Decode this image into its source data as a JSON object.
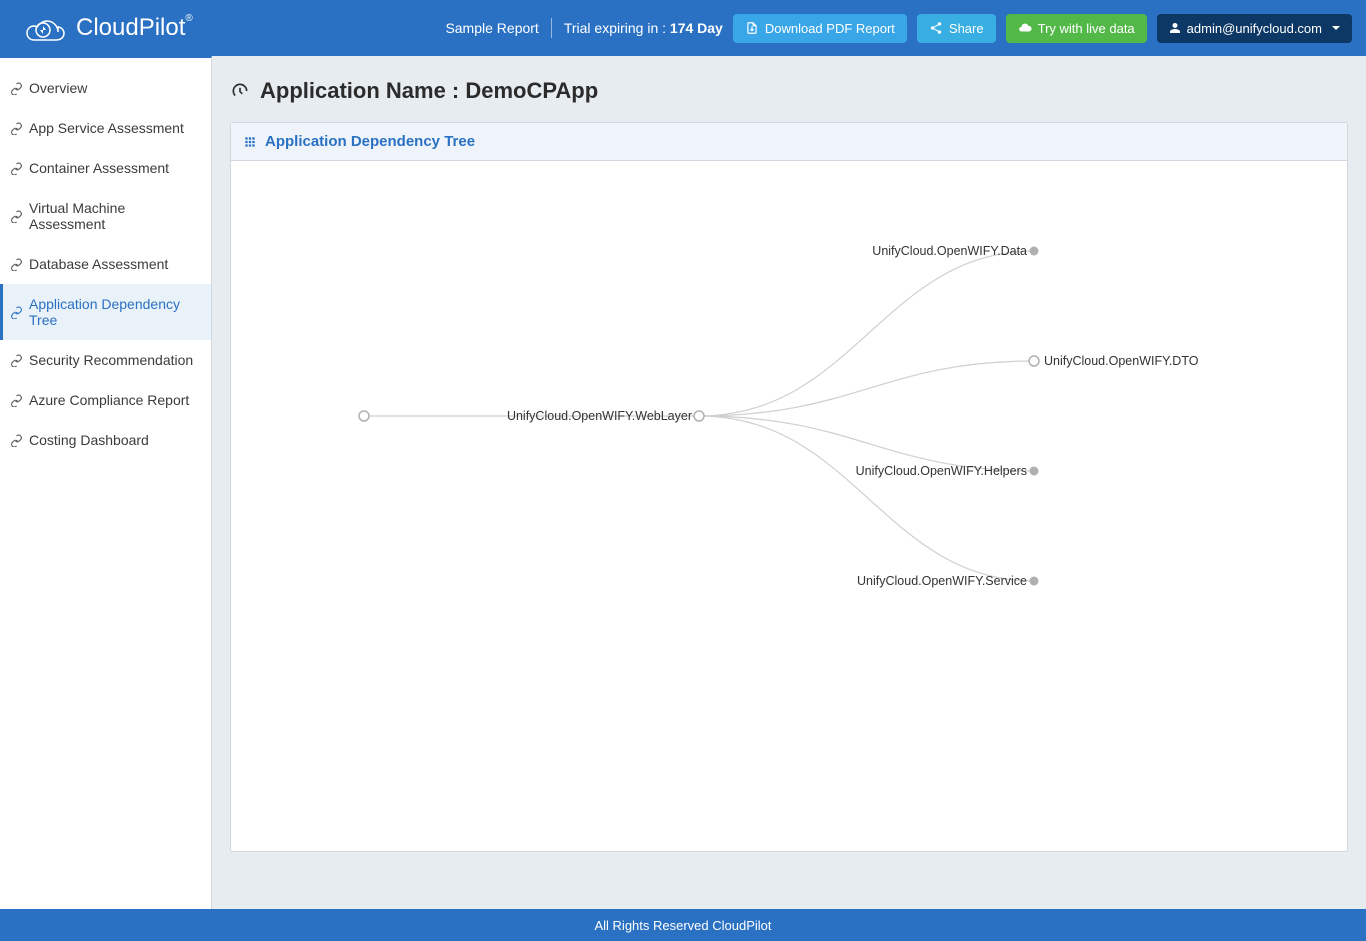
{
  "header": {
    "brand_name": "CloudPilot",
    "brand_trademark": "®",
    "sample_report_link": "Sample Report",
    "trial_prefix": "Trial expiring in : ",
    "trial_days": "174 Day",
    "download_btn": "Download PDF Report",
    "share_btn": "Share",
    "try_live_btn": "Try with live data",
    "user_email": "admin@unifycloud.com"
  },
  "sidebar": {
    "items": [
      {
        "label": "Overview"
      },
      {
        "label": "App Service Assessment"
      },
      {
        "label": "Container Assessment"
      },
      {
        "label": "Virtual Machine Assessment"
      },
      {
        "label": "Database Assessment"
      },
      {
        "label": "Application Dependency Tree"
      },
      {
        "label": "Security Recommendation"
      },
      {
        "label": "Azure Compliance Report"
      },
      {
        "label": "Costing Dashboard"
      }
    ],
    "active_index": 5
  },
  "page": {
    "title_prefix": "Application Name : ",
    "app_name": "DemoCPApp",
    "panel_title": "Application Dependency Tree"
  },
  "tree": {
    "root": {
      "label": ""
    },
    "mid": {
      "label": "UnifyCloud.OpenWIFY.WebLayer"
    },
    "leaves": [
      {
        "label": "UnifyCloud.OpenWIFY.Data",
        "filled": true
      },
      {
        "label": "UnifyCloud.OpenWIFY.DTO",
        "filled": false
      },
      {
        "label": "UnifyCloud.OpenWIFY.Helpers",
        "filled": true
      },
      {
        "label": "UnifyCloud.OpenWIFY.Service",
        "filled": true
      }
    ]
  },
  "footer": {
    "text": "All Rights Reserved CloudPilot"
  }
}
